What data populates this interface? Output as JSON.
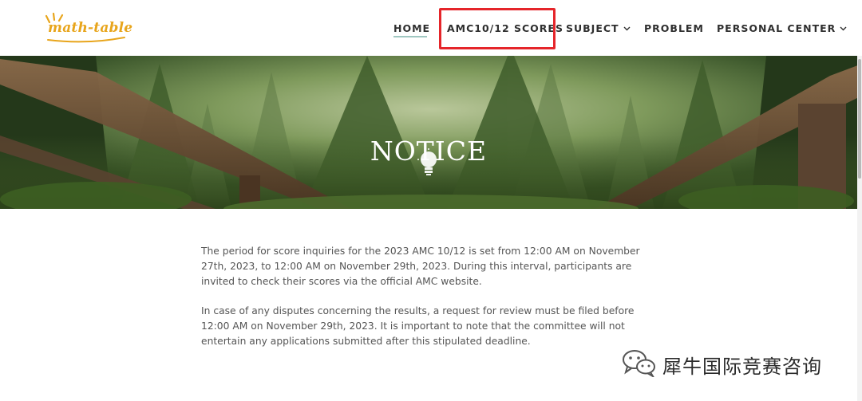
{
  "header": {
    "logo_text": "math-table",
    "nav": [
      {
        "label": "HOME",
        "active": true
      },
      {
        "label": "AMC10/12 SCORES",
        "highlighted": true
      },
      {
        "label": "SUBJECT",
        "dropdown": true
      },
      {
        "label": "PROBLEM"
      },
      {
        "label": "PERSONAL CENTER",
        "dropdown": true
      }
    ]
  },
  "hero": {
    "icon": "lightbulb-icon",
    "title": "NOTICE"
  },
  "content": {
    "paragraphs": [
      "The period for score inquiries for the 2023 AMC 10/12 is set from 12:00 AM on November 27th, 2023, to 12:00 AM on November 29th, 2023. During this interval, participants are invited to check their scores via the official AMC website.",
      "In case of any disputes concerning the results, a request for review must be filed before 12:00 AM on November 29th, 2023. It is important to note that the committee will not entertain any applications submitted after this stipulated deadline."
    ]
  },
  "watermark": {
    "text": "犀牛国际竞赛咨询",
    "icon": "wechat-icon"
  },
  "colors": {
    "highlight_border": "#e5252a",
    "logo": "#e8a51c",
    "home_underline": "#9fc7c1",
    "body_text": "#555555"
  }
}
